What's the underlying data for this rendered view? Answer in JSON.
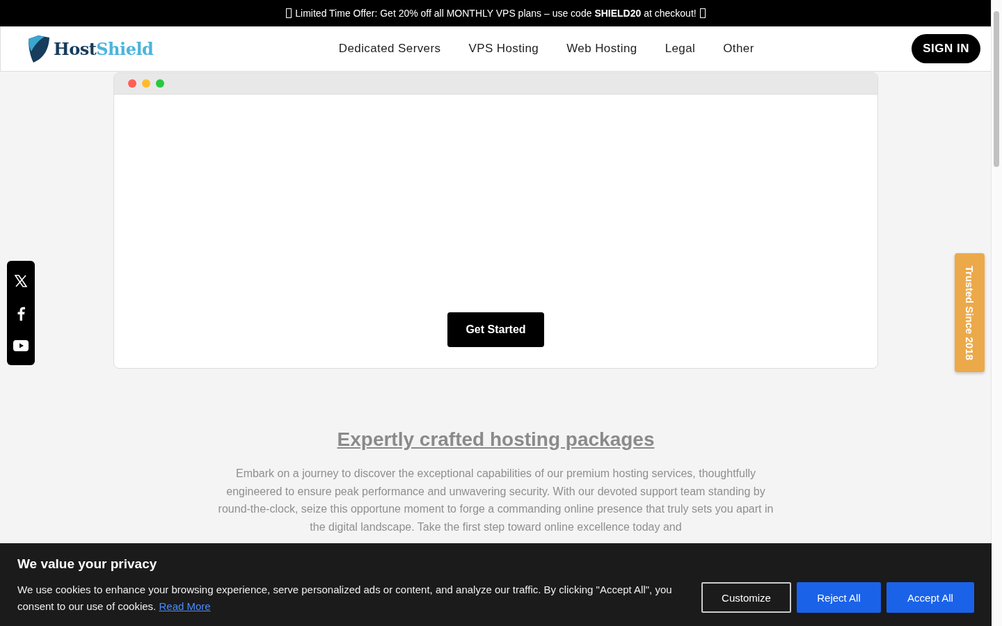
{
  "promo_banner": {
    "text_before": "Limited Time Offer: Get 20% off all MONTHLY VPS plans – use code ",
    "code": "SHIELD20",
    "text_after": " at checkout!"
  },
  "header": {
    "logo": {
      "part1": "Host",
      "part2": "Shield"
    },
    "nav": [
      "Dedicated Servers",
      "VPS Hosting",
      "Web Hosting",
      "Legal",
      "Other"
    ],
    "sign_in": "SIGN IN"
  },
  "hero": {
    "window_dots": [
      {
        "color": "#ff5f57"
      },
      {
        "color": "#febc2e"
      },
      {
        "color": "#28c840"
      }
    ],
    "button": "Get Started"
  },
  "social": [
    {
      "kind": "x"
    },
    {
      "kind": "facebook"
    },
    {
      "kind": "youtube"
    }
  ],
  "trusted_tab": "Trusted Since 2018",
  "section": {
    "title": "Expertly crafted hosting packages",
    "text": "Embark on a journey to discover the exceptional capabilities of our premium hosting services, thoughtfully engineered to ensure peak performance and unwavering security. With our devoted support team standing by round-the-clock, seize this opportune moment to forge a commanding online presence that truly sets you apart in the digital landscape. Take the first step toward online excellence today and"
  },
  "cookie_banner": {
    "title": "We value your privacy",
    "text": "We use cookies to enhance your browsing experience, serve personalized ads or content, and analyze our traffic. By clicking \"Accept All\", you consent to our use of cookies.",
    "link": "Read More",
    "buttons": [
      {
        "label": "Customize",
        "kind": "outline"
      },
      {
        "label": "Reject All",
        "kind": "solid"
      },
      {
        "label": "Accept All",
        "kind": "solid"
      }
    ]
  }
}
